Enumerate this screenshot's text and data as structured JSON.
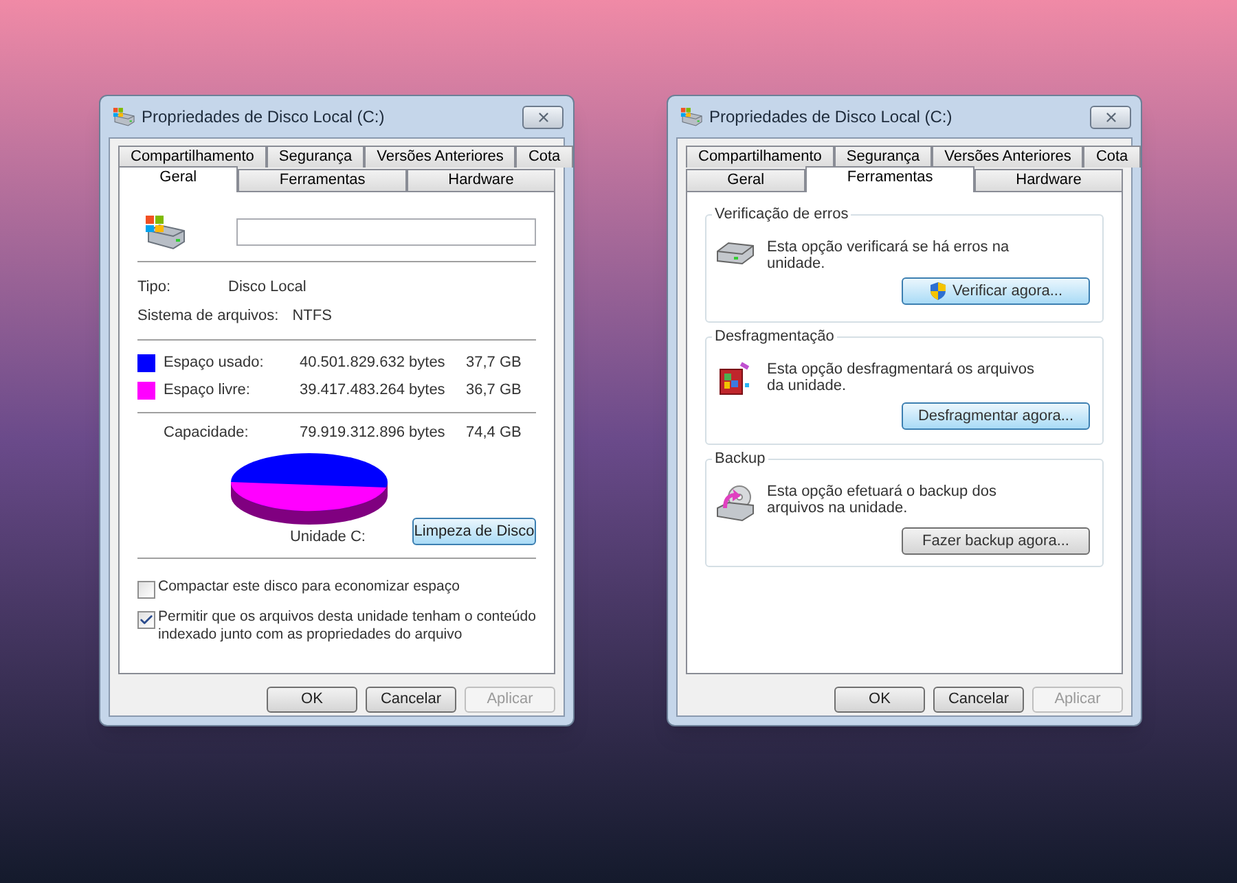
{
  "dialogs": [
    {
      "title": "Propriedades de Disco Local (C:)",
      "kind": "general",
      "tab_rows": [
        [
          {
            "label": "Compartilhamento",
            "selected": false
          },
          {
            "label": "Segurança",
            "selected": false
          },
          {
            "label": "Versões Anteriores",
            "selected": false
          },
          {
            "label": "Cota",
            "selected": false
          }
        ],
        [
          {
            "label": "Geral",
            "selected": true
          },
          {
            "label": "Ferramentas",
            "selected": false
          },
          {
            "label": "Hardware",
            "selected": false
          }
        ]
      ],
      "info": [
        {
          "label": "Tipo:",
          "value": "Disco Local"
        },
        {
          "label": "Sistema de arquivos:",
          "value": "NTFS"
        }
      ],
      "space": [
        {
          "label": "Espaço usado:",
          "bytes": "40.501.829.632 bytes",
          "size": "37,7 GB",
          "color": "#0000ff"
        },
        {
          "label": "Espaço livre:",
          "bytes": "39.417.483.264 bytes",
          "size": "36,7 GB",
          "color": "#ff00ff"
        }
      ],
      "capacity": {
        "label": "Capacidade:",
        "bytes": "79.919.312.896 bytes",
        "size": "74,4 GB"
      },
      "drive_label": "Unidade C:",
      "cleanup_button": {
        "label": "Limpeza de Disco",
        "highlighted": true
      },
      "options": [
        {
          "label": "Compactar este disco para economizar espaço",
          "checked": false
        },
        {
          "label": "Permitir que os arquivos desta unidade tenham o conteúdo indexado junto com as propriedades do arquivo",
          "checked": true
        }
      ],
      "buttons": [
        {
          "label": "OK",
          "disabled": false
        },
        {
          "label": "Cancelar",
          "disabled": false
        },
        {
          "label": "Aplicar",
          "disabled": true
        }
      ]
    },
    {
      "title": "Propriedades de Disco Local (C:)",
      "kind": "tools",
      "tab_rows": [
        [
          {
            "label": "Compartilhamento",
            "selected": false
          },
          {
            "label": "Segurança",
            "selected": false
          },
          {
            "label": "Versões Anteriores",
            "selected": false
          },
          {
            "label": "Cota",
            "selected": false
          }
        ],
        [
          {
            "label": "Geral",
            "selected": false
          },
          {
            "label": "Ferramentas",
            "selected": true
          },
          {
            "label": "Hardware",
            "selected": false
          }
        ]
      ],
      "groups": [
        {
          "kind": "check",
          "title": "Verificação de erros",
          "description": "Esta opção verificará se há erros na unidade.",
          "button": {
            "label": "Verificar agora...",
            "shield": true,
            "highlighted": true
          }
        },
        {
          "kind": "defrag",
          "title": "Desfragmentação",
          "description": "Esta opção desfragmentará os arquivos da unidade.",
          "button": {
            "label": "Desfragmentar agora...",
            "shield": false,
            "highlighted": true
          }
        },
        {
          "kind": "backup",
          "title": "Backup",
          "description": "Esta opção efetuará o backup dos arquivos na unidade.",
          "button": {
            "label": "Fazer backup agora...",
            "shield": false,
            "highlighted": false
          }
        }
      ],
      "buttons": [
        {
          "label": "OK",
          "disabled": false
        },
        {
          "label": "Cancelar",
          "disabled": false
        },
        {
          "label": "Aplicar",
          "disabled": true
        }
      ]
    }
  ]
}
